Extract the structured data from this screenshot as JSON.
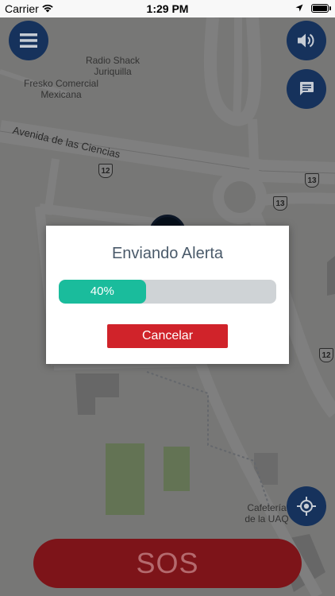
{
  "status_bar": {
    "carrier": "Carrier",
    "time": "1:29 PM"
  },
  "map": {
    "road_name": "Avenida de las Ciencias",
    "places": [
      {
        "name": "Radio Shack\nJuriquilla"
      },
      {
        "name": "Fresko Comercial\nMexicana"
      },
      {
        "name": "Cafetería\nde la UAQ"
      }
    ],
    "highway_shields": [
      "12",
      "13",
      "13",
      "12"
    ]
  },
  "buttons": {
    "menu_icon": "hamburger-menu-icon",
    "sound_icon": "speaker-icon",
    "chat_icon": "chat-bubble-icon",
    "locate_icon": "crosshair-location-icon"
  },
  "dialog": {
    "title": "Enviando Alerta",
    "progress_percent": 40,
    "progress_label": "40%",
    "cancel_label": "Cancelar"
  },
  "sos": {
    "label": "SOS"
  },
  "colors": {
    "primary_navy": "#16325c",
    "progress_teal": "#1abc9c",
    "cancel_red": "#d0232a",
    "sos_red": "#7d1419"
  }
}
